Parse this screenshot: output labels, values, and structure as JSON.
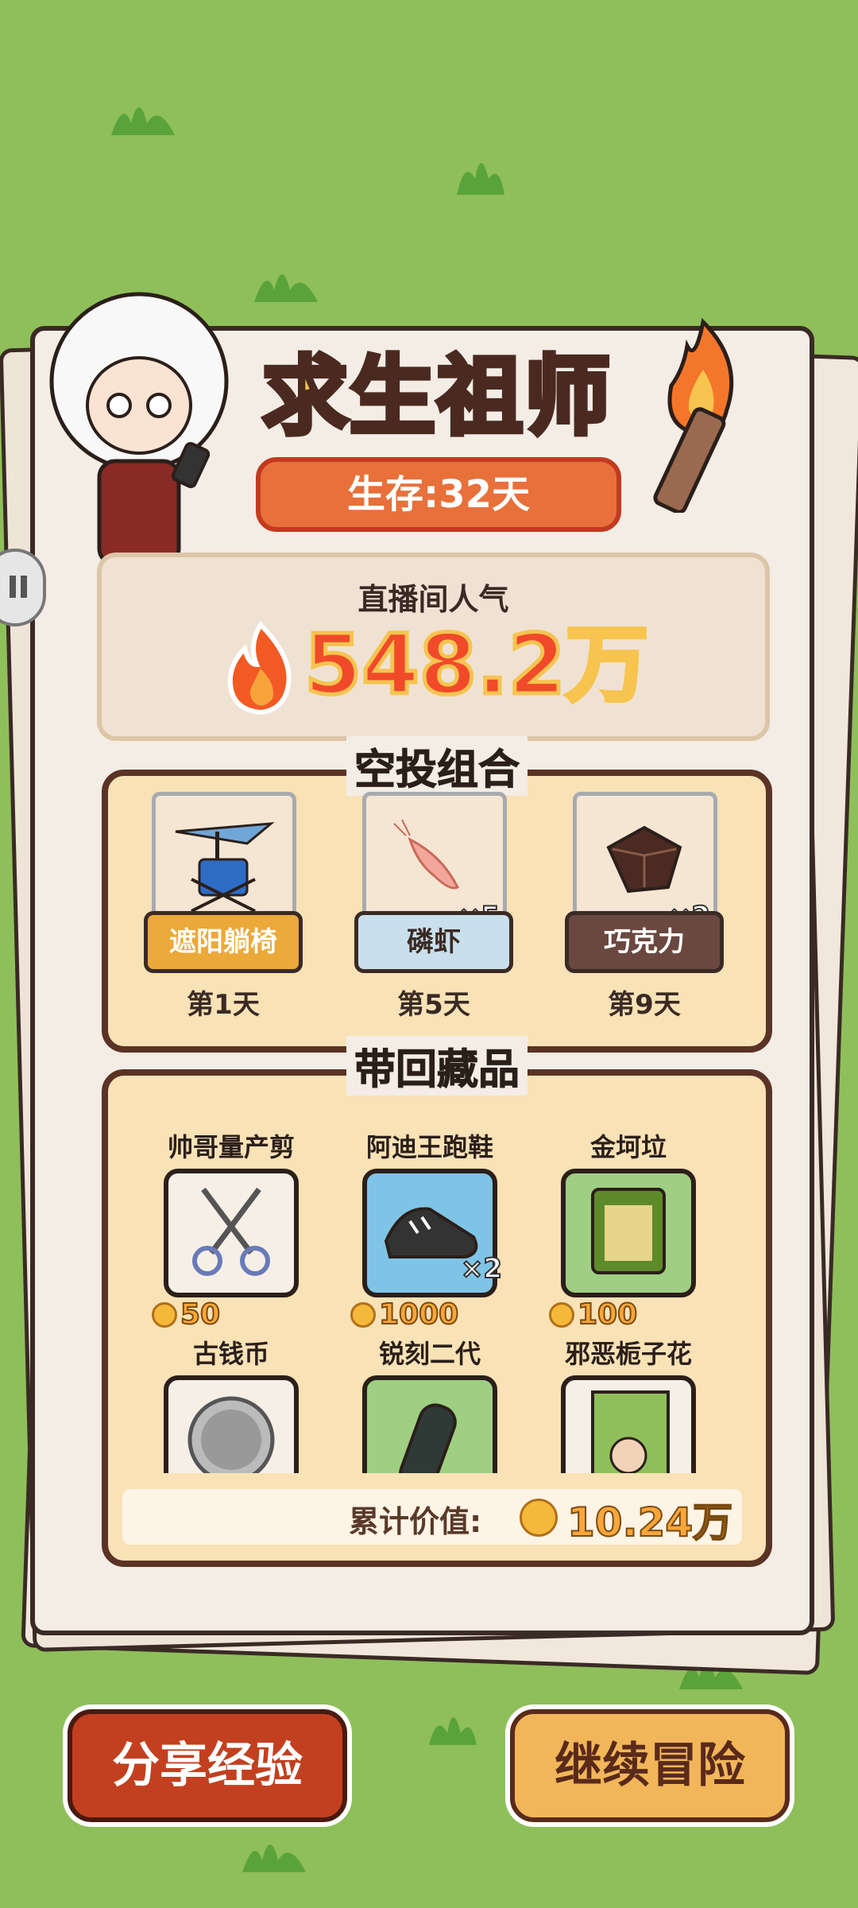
{
  "title": "求生祖师",
  "survival": "生存:32天",
  "popularity": {
    "label": "直播间人气",
    "value": "548.2万"
  },
  "airdrop": {
    "title": "空投组合",
    "items": [
      {
        "name": "遮阳躺椅",
        "count": "",
        "day": "第1天",
        "tag_color": "#eba93a",
        "tag_text_color": "#ffffff"
      },
      {
        "name": "磷虾",
        "count": "×5",
        "day": "第5天",
        "tag_color": "#c9e0ec",
        "tag_text_color": "#3a2a25"
      },
      {
        "name": "巧克力",
        "count": "×2",
        "day": "第9天",
        "tag_color": "#6a4840",
        "tag_text_color": "#ffffff"
      }
    ]
  },
  "collection": {
    "title": "带回藏品",
    "items": [
      {
        "name": "帅哥量产剪",
        "price": "50",
        "count": "",
        "bg": "#f5efe6",
        "icon": "scissors-icon"
      },
      {
        "name": "阿迪王跑鞋",
        "price": "1000",
        "count": "×2",
        "bg": "#7fc4e6",
        "icon": "shoe-icon"
      },
      {
        "name": "金坷垃",
        "price": "100",
        "count": "",
        "bg": "#9fcf82",
        "icon": "fertilizer-bag-icon"
      },
      {
        "name": "古钱币",
        "price": "",
        "count": "",
        "bg": "#f5efe6",
        "icon": "coin-portrait-icon"
      },
      {
        "name": "锐刻二代",
        "price": "",
        "count": "",
        "bg": "#9fcf82",
        "icon": "vape-icon"
      },
      {
        "name": "邪恶栀子花",
        "price": "",
        "count": "",
        "bg": "#f5efe6",
        "icon": "book-icon"
      }
    ],
    "total_label": "累计价值:",
    "total_value": "10.24万"
  },
  "buttons": {
    "share": "分享经验",
    "continue": "继续冒险"
  }
}
